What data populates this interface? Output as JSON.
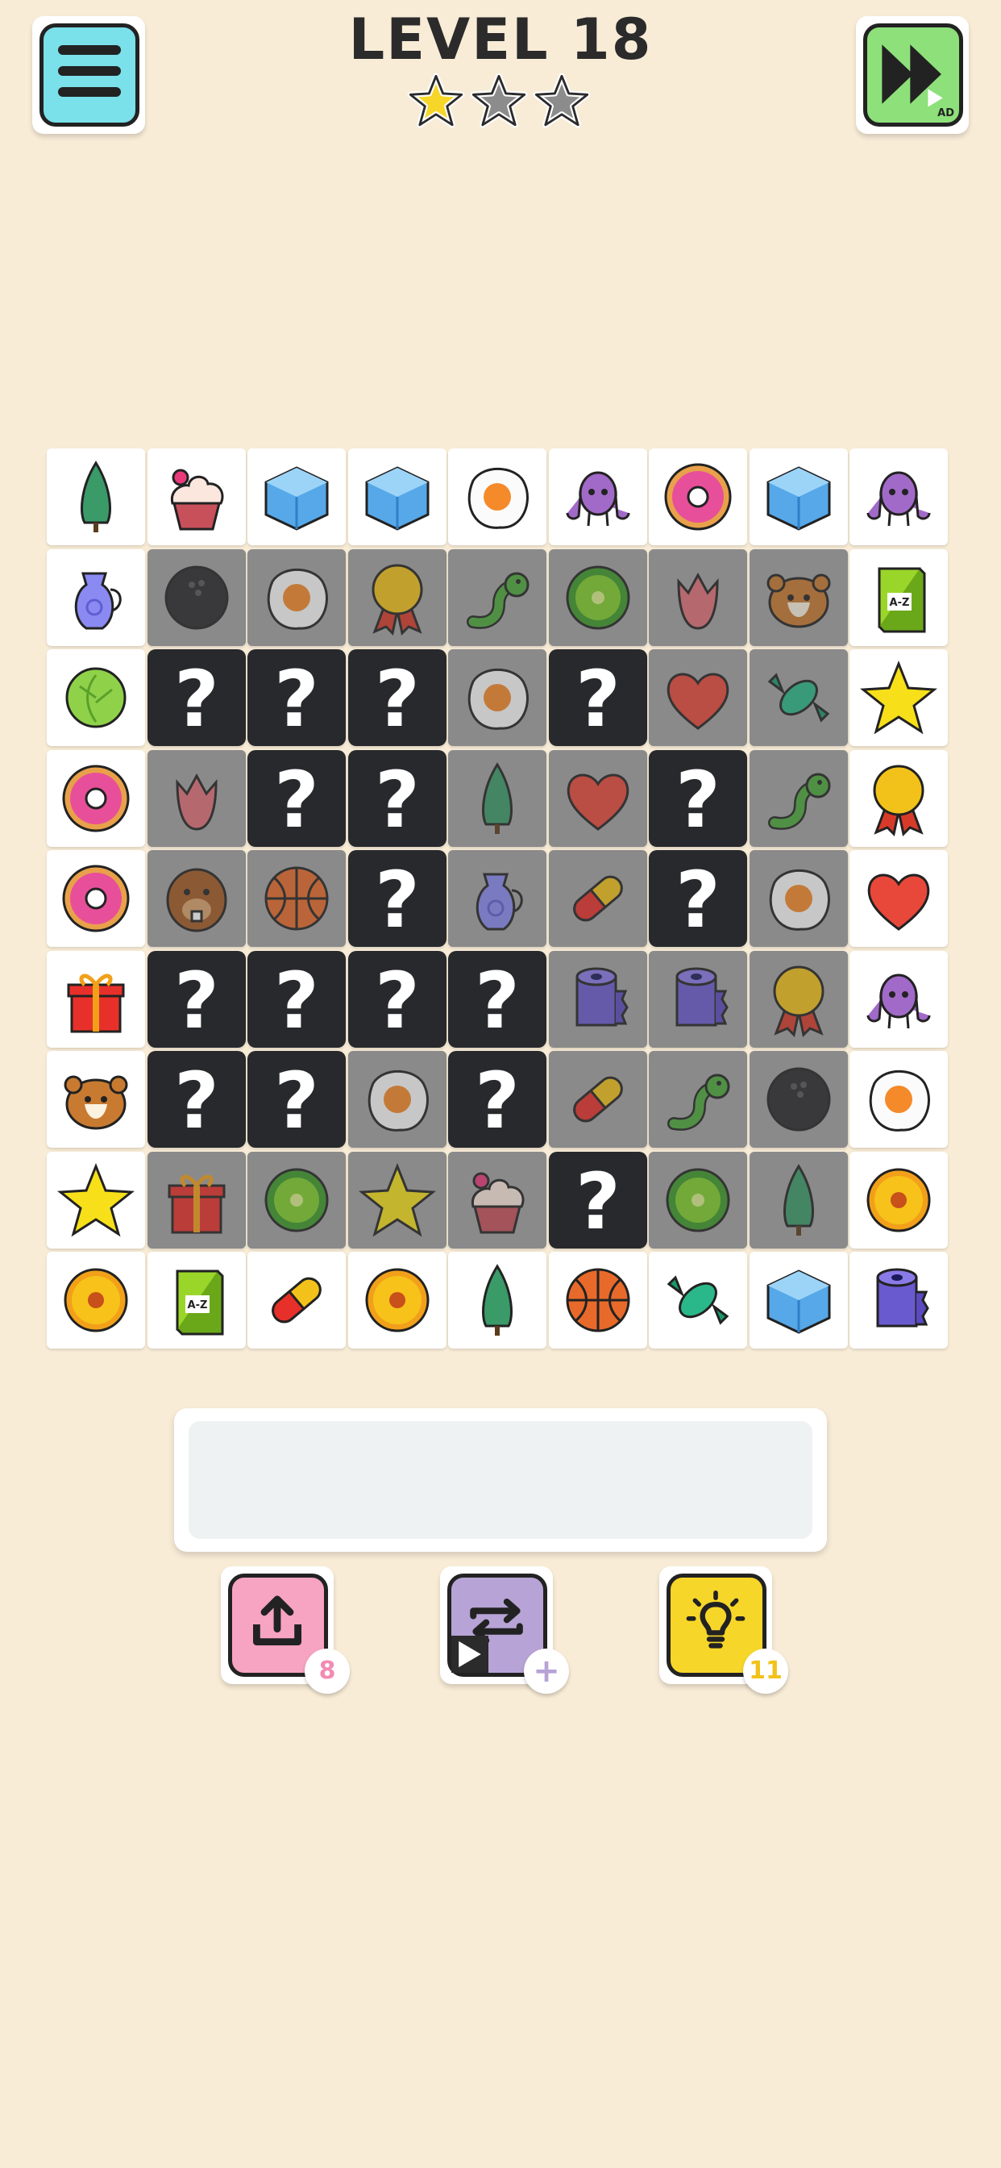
{
  "header": {
    "level_title": "LEVEL 18",
    "stars_earned": 1,
    "stars_total": 3,
    "menu_icon": "hamburger-menu-icon",
    "skip_icon": "fast-forward-icon",
    "skip_ad_label": "AD"
  },
  "board": {
    "rows": 9,
    "cols": 9,
    "tiles": [
      [
        {
          "item": "tree",
          "state": "open"
        },
        {
          "item": "cupcake",
          "state": "open"
        },
        {
          "item": "ice-cube",
          "state": "open"
        },
        {
          "item": "ice-cube",
          "state": "open"
        },
        {
          "item": "fried-egg",
          "state": "open"
        },
        {
          "item": "octopus",
          "state": "open"
        },
        {
          "item": "donut",
          "state": "open"
        },
        {
          "item": "ice-cube",
          "state": "open"
        },
        {
          "item": "octopus",
          "state": "open"
        }
      ],
      [
        {
          "item": "jug",
          "state": "open"
        },
        {
          "item": "bowling-ball",
          "state": "dim"
        },
        {
          "item": "fried-egg",
          "state": "dim"
        },
        {
          "item": "medal",
          "state": "dim"
        },
        {
          "item": "worm",
          "state": "dim"
        },
        {
          "item": "kiwi",
          "state": "dim"
        },
        {
          "item": "tulip",
          "state": "dim"
        },
        {
          "item": "hamster",
          "state": "dim"
        },
        {
          "item": "dictionary",
          "state": "open"
        }
      ],
      [
        {
          "item": "lettuce",
          "state": "open"
        },
        {
          "item": "unknown",
          "state": "hidden"
        },
        {
          "item": "unknown",
          "state": "hidden"
        },
        {
          "item": "unknown",
          "state": "hidden"
        },
        {
          "item": "fried-egg",
          "state": "dim"
        },
        {
          "item": "unknown",
          "state": "hidden"
        },
        {
          "item": "heart",
          "state": "dim"
        },
        {
          "item": "candy",
          "state": "dim"
        },
        {
          "item": "star",
          "state": "open"
        }
      ],
      [
        {
          "item": "donut",
          "state": "open"
        },
        {
          "item": "tulip",
          "state": "dim"
        },
        {
          "item": "unknown",
          "state": "hidden"
        },
        {
          "item": "unknown",
          "state": "hidden"
        },
        {
          "item": "tree",
          "state": "dim"
        },
        {
          "item": "heart",
          "state": "dim"
        },
        {
          "item": "unknown",
          "state": "hidden"
        },
        {
          "item": "worm",
          "state": "dim"
        },
        {
          "item": "medal",
          "state": "open"
        }
      ],
      [
        {
          "item": "donut",
          "state": "open"
        },
        {
          "item": "beaver",
          "state": "dim"
        },
        {
          "item": "basketball",
          "state": "dim"
        },
        {
          "item": "unknown",
          "state": "hidden"
        },
        {
          "item": "jug",
          "state": "dim"
        },
        {
          "item": "pill",
          "state": "dim"
        },
        {
          "item": "unknown",
          "state": "hidden"
        },
        {
          "item": "fried-egg",
          "state": "dim"
        },
        {
          "item": "heart",
          "state": "open"
        }
      ],
      [
        {
          "item": "gift",
          "state": "open"
        },
        {
          "item": "unknown",
          "state": "hidden"
        },
        {
          "item": "unknown",
          "state": "hidden"
        },
        {
          "item": "unknown",
          "state": "hidden"
        },
        {
          "item": "unknown",
          "state": "hidden"
        },
        {
          "item": "toilet-paper",
          "state": "dim"
        },
        {
          "item": "toilet-paper",
          "state": "dim"
        },
        {
          "item": "medal",
          "state": "dim"
        },
        {
          "item": "octopus",
          "state": "open"
        }
      ],
      [
        {
          "item": "hamster",
          "state": "open"
        },
        {
          "item": "unknown",
          "state": "hidden"
        },
        {
          "item": "unknown",
          "state": "hidden"
        },
        {
          "item": "fried-egg",
          "state": "dim"
        },
        {
          "item": "unknown",
          "state": "hidden"
        },
        {
          "item": "pill",
          "state": "dim"
        },
        {
          "item": "worm",
          "state": "dim"
        },
        {
          "item": "bowling-ball",
          "state": "dim"
        },
        {
          "item": "fried-egg",
          "state": "open"
        }
      ],
      [
        {
          "item": "star",
          "state": "open"
        },
        {
          "item": "gift",
          "state": "dim"
        },
        {
          "item": "kiwi",
          "state": "dim"
        },
        {
          "item": "star",
          "state": "dim"
        },
        {
          "item": "cupcake",
          "state": "dim"
        },
        {
          "item": "unknown",
          "state": "hidden"
        },
        {
          "item": "kiwi",
          "state": "dim"
        },
        {
          "item": "tree",
          "state": "dim"
        },
        {
          "item": "flower",
          "state": "open"
        }
      ],
      [
        {
          "item": "flower",
          "state": "open"
        },
        {
          "item": "dictionary",
          "state": "open"
        },
        {
          "item": "pill",
          "state": "open"
        },
        {
          "item": "flower",
          "state": "open"
        },
        {
          "item": "tree",
          "state": "open"
        },
        {
          "item": "basketball",
          "state": "open"
        },
        {
          "item": "candy",
          "state": "open"
        },
        {
          "item": "ice-cube",
          "state": "open"
        },
        {
          "item": "toilet-paper",
          "state": "open"
        }
      ]
    ],
    "hidden_symbol": "?",
    "book_label": "A-Z"
  },
  "tray": {
    "slots_filled": 0
  },
  "powerups": {
    "undo": {
      "icon": "undo-arrow-icon",
      "count": "8"
    },
    "shuffle": {
      "icon": "shuffle-icon",
      "count": "+",
      "ad_label": "AD"
    },
    "hint": {
      "icon": "lightbulb-icon",
      "count": "11"
    }
  },
  "colors": {
    "background": "#f8ecd7",
    "menu": "#7ae0ea",
    "skip": "#8ee07a",
    "undo": "#f7a3c2",
    "shuffle": "#b7a3d6",
    "hint": "#f7d62a",
    "hidden_tile": "#27292d",
    "dim_tile": "#a1a1a1"
  }
}
